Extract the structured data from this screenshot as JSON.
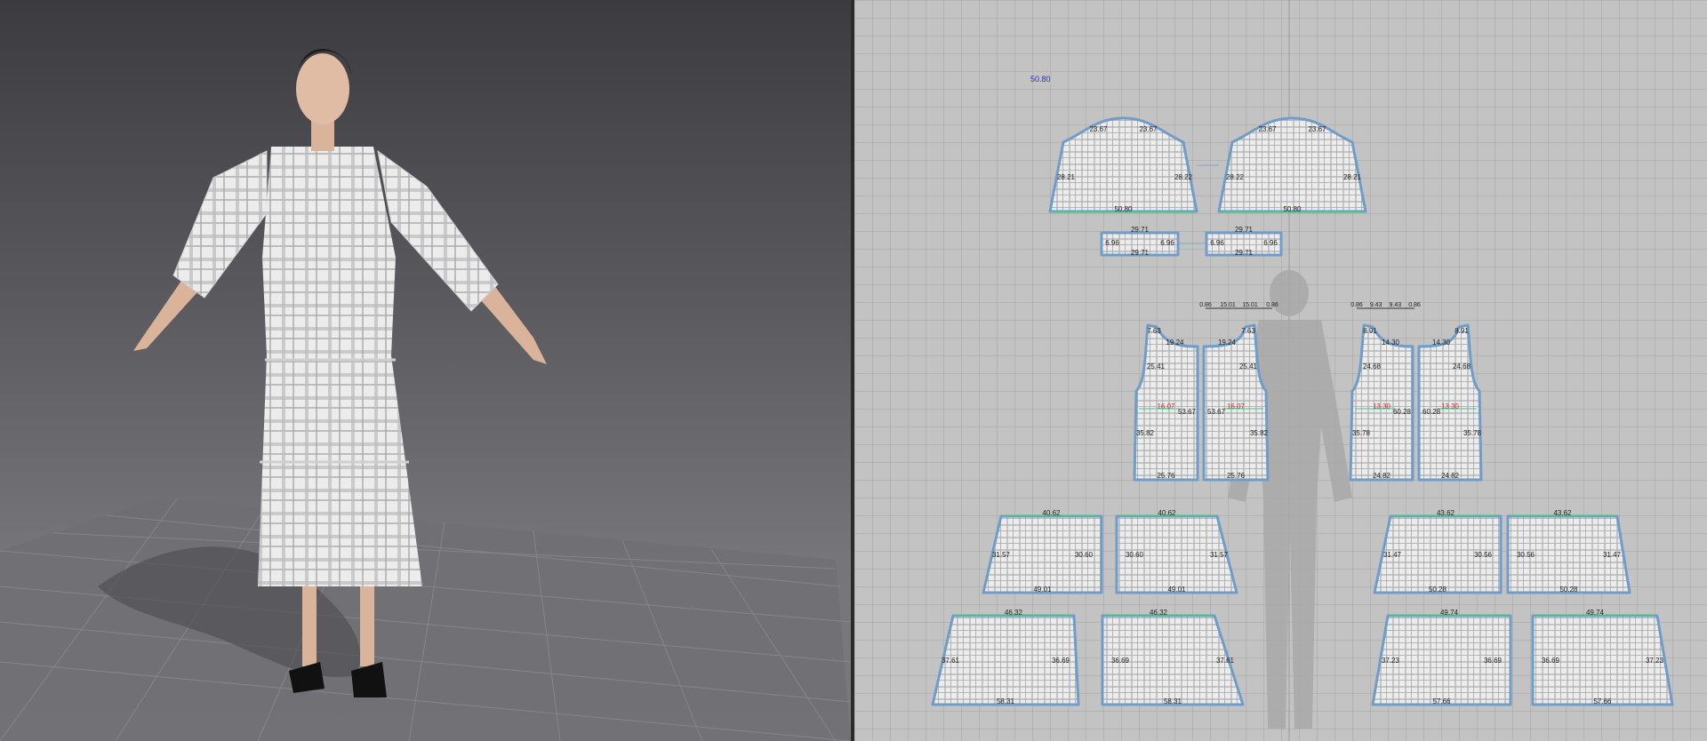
{
  "pattern_view": {
    "top_label": "50.80",
    "sleeves": [
      {
        "top_left": "23.67",
        "top_right": "23.67",
        "left": "28.21",
        "right": "28.22",
        "bottom": "50.80"
      },
      {
        "top_left": "23.67",
        "top_right": "23.67",
        "left": "28.22",
        "right": "28.21",
        "bottom": "50.80"
      }
    ],
    "cuffs": [
      {
        "top": "29.71",
        "bottom": "29.71",
        "left": "6.96",
        "right": "6.96"
      },
      {
        "top": "29.71",
        "bottom": "29.71",
        "left": "6.96",
        "right": "6.96"
      }
    ],
    "bodice_front": {
      "top_markers": [
        "0.86",
        "15.01",
        "15.01",
        "0.86"
      ],
      "left": {
        "shoulder": "7.63",
        "neck": "19.24",
        "armhole": "25.41",
        "dart": "16.07",
        "center": "53.67",
        "side": "35.82",
        "hem": "25.76"
      },
      "right": {
        "shoulder": "7.63",
        "neck": "19.24",
        "armhole": "25.41",
        "dart": "16.07",
        "center": "53.67",
        "side": "35.82",
        "hem": "25.76"
      }
    },
    "bodice_back": {
      "top_markers": [
        "0.86",
        "9.43",
        "9.43",
        "0.86"
      ],
      "left": {
        "shoulder": "8.91",
        "neck": "14.30",
        "armhole": "24.68",
        "dart": "13.30",
        "center": "60.28",
        "side": "35.78",
        "hem": "24.82"
      },
      "right": {
        "shoulder": "8.91",
        "neck": "14.30",
        "armhole": "24.68",
        "dart": "13.30",
        "center": "60.28",
        "side": "35.78",
        "hem": "24.82"
      }
    },
    "tier1": [
      {
        "top": "40.62",
        "left": "31.57",
        "right": "30.60",
        "bottom": "49.01"
      },
      {
        "top": "40.62",
        "left": "30.60",
        "right": "31.57",
        "bottom": "49.01"
      },
      {
        "top": "43.62",
        "left": "31.47",
        "right": "30.56",
        "bottom": "50.28"
      },
      {
        "top": "43.62",
        "left": "30.56",
        "right": "31.47",
        "bottom": "50.28"
      }
    ],
    "tier2": [
      {
        "top": "46.32",
        "left": "37.61",
        "right": "36.69",
        "bottom": "58.31"
      },
      {
        "top": "46.32",
        "left": "36.69",
        "right": "37.61",
        "bottom": "58.31"
      },
      {
        "top": "49.74",
        "left": "37.23",
        "right": "36.69",
        "bottom": "57.66"
      },
      {
        "top": "49.74",
        "left": "36.69",
        "right": "37.23",
        "bottom": "57.66"
      }
    ]
  },
  "colors": {
    "outline": "#6f9cc9",
    "stitch": "#4cbf8a",
    "fabric": "#ececec",
    "plaid": "#b4b4b4",
    "label": "#222222",
    "dart": "#c0392b"
  }
}
